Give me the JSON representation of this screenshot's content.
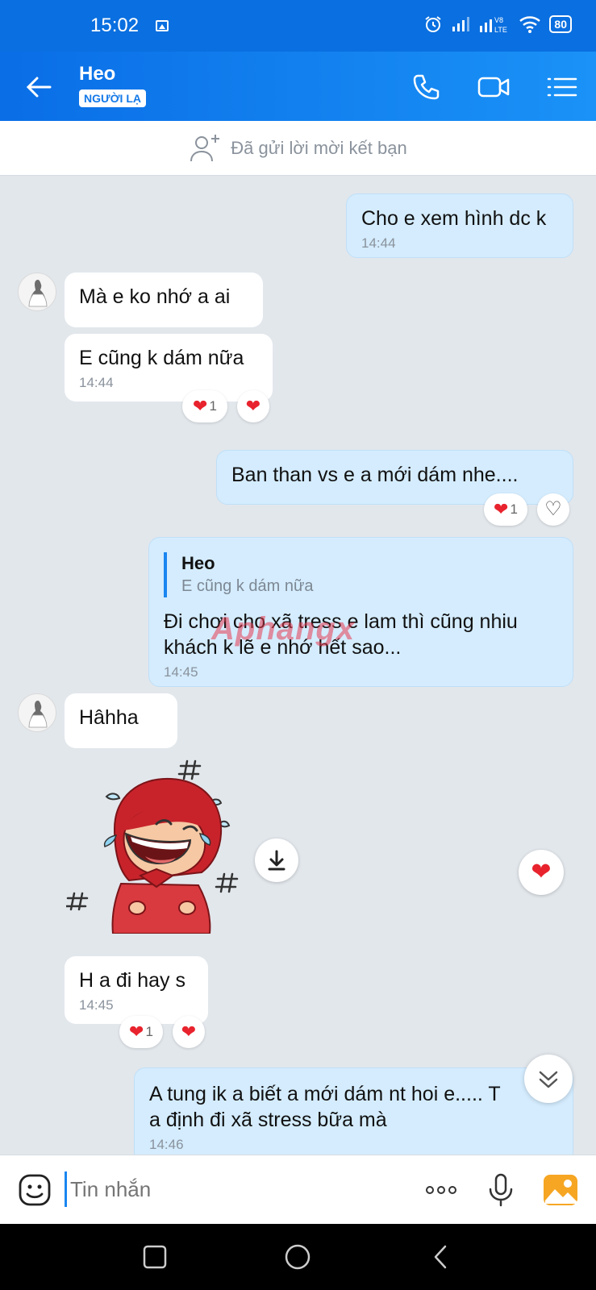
{
  "status_bar": {
    "time": "15:02",
    "battery": "80"
  },
  "header": {
    "name": "Heo",
    "badge": "NGƯỜI LẠ"
  },
  "friend_banner": {
    "text": "Đã gửi lời mời kết bạn"
  },
  "messages": [
    {
      "dir": "out",
      "text": "Cho e xem hình dc k",
      "time": "14:44"
    },
    {
      "dir": "in",
      "text": "Mà e ko nhớ a ai"
    },
    {
      "dir": "in",
      "text": "E cũng k dám nữa",
      "time": "14:44",
      "reaction_count": "1"
    },
    {
      "dir": "out",
      "text": "Ban than vs e a  mới dám nhe....",
      "reaction_count": "1"
    },
    {
      "dir": "out",
      "quote_name": "Heo",
      "quote_text": "E cũng k dám nữa",
      "text": "Đi chơi cho xã tress e lam thì cũng nhiu khách k lẽ e nhớ hết sao...",
      "time": "14:45"
    },
    {
      "dir": "in",
      "text": "Hâhha"
    },
    {
      "dir": "in",
      "text": "H a đi hay s",
      "time": "14:45",
      "reaction_count": "1"
    },
    {
      "dir": "out",
      "text": "A tung ik a biết a mới dám nt hoi e..... T a định đi xã stress bữa mà",
      "time": "14:46"
    }
  ],
  "watermark": "Aphangx",
  "input": {
    "placeholder": "Tin nhắn"
  },
  "colors": {
    "header": "#1a86f0",
    "outgoing_bubble": "#d4ecfe",
    "heart": "#e8232d"
  }
}
